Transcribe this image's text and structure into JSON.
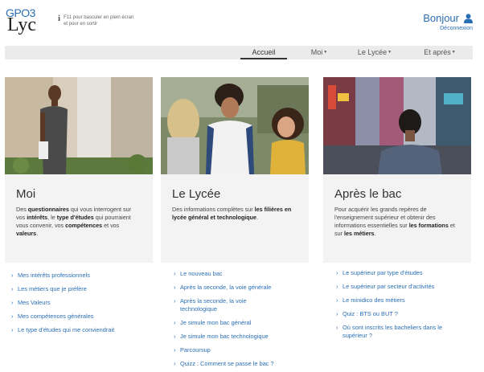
{
  "header": {
    "logo_top": "GPO3",
    "logo_bottom": "Lyc",
    "fullscreen_hint": "F11 pour basculer en plein écran et pour en sortir",
    "greeting": "Bonjour",
    "logout": "Déconnexion"
  },
  "nav": {
    "tabs": [
      {
        "label": "Accueil"
      },
      {
        "label": "Moi"
      },
      {
        "label": "Le Lycée"
      },
      {
        "label": "Et après"
      }
    ]
  },
  "cards": [
    {
      "title": "Moi",
      "desc_parts": [
        "Des ",
        "questionnaires",
        " qui vous interrogent sur vos ",
        "intérêts",
        ", le ",
        "type d'études",
        " qui pourraient vous convenir, vos ",
        "compétences",
        " et vos ",
        "valeurs",
        "."
      ],
      "links": [
        "Mes intérêts professionnels",
        "Les métiers que je préfère",
        "Mes Valeurs",
        "Mes compétences générales",
        "Le type d'études qui me conviendrait"
      ]
    },
    {
      "title": "Le Lycée",
      "desc_parts": [
        "Des informations complètes sur ",
        "les filières en lycée général et technologique",
        "."
      ],
      "links": [
        "Le nouveau bac",
        "Après la seconde, la voie générale",
        "Après la seconde, la voie technologique",
        "Je simule mon bac général",
        "Je simule mon bac technologique",
        "Parcoursup",
        "Quizz : Comment se passe le bac ?"
      ]
    },
    {
      "title": "Après le bac",
      "desc_parts": [
        "Pour acquérir les grands repères de l'enseignement supérieur et obtenir des informations essentielles sur ",
        "les formations",
        " et sur ",
        "les métiers",
        "."
      ],
      "links": [
        "Le supérieur par type d'études",
        "Le supérieur par secteur d'activités",
        "Le minidico des métiers",
        "Quiz : BTS ou BUT ?",
        "Où sont inscrits les bacheliers dans le supérieur ?"
      ]
    }
  ]
}
